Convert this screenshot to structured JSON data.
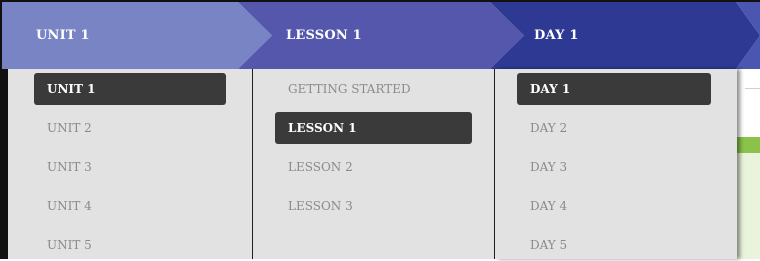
{
  "breadcrumb": {
    "unit": {
      "label": "UNIT 1",
      "color": "#7884c3"
    },
    "lesson": {
      "label": "LESSON 1",
      "color": "#5557ad"
    },
    "day": {
      "label": "DAY 1",
      "color": "#2e3994"
    }
  },
  "dropdowns": {
    "unit": {
      "selected": "UNIT 1",
      "items": [
        "UNIT 1",
        "UNIT 2",
        "UNIT 3",
        "UNIT 4",
        "UNIT 5"
      ]
    },
    "lesson": {
      "selected": "LESSON 1",
      "items": [
        "GETTING STARTED",
        "LESSON 1",
        "LESSON 2",
        "LESSON 3"
      ]
    },
    "day": {
      "selected": "DAY 1",
      "items": [
        "DAY 1",
        "DAY 2",
        "DAY 3",
        "DAY 4",
        "DAY 5"
      ]
    }
  },
  "colors": {
    "dropdown_bg": "#e2e2e2",
    "selected_bg": "#3a3a3a",
    "unselected_text": "#8a8a8a",
    "accent_green": "#8bc34a"
  }
}
